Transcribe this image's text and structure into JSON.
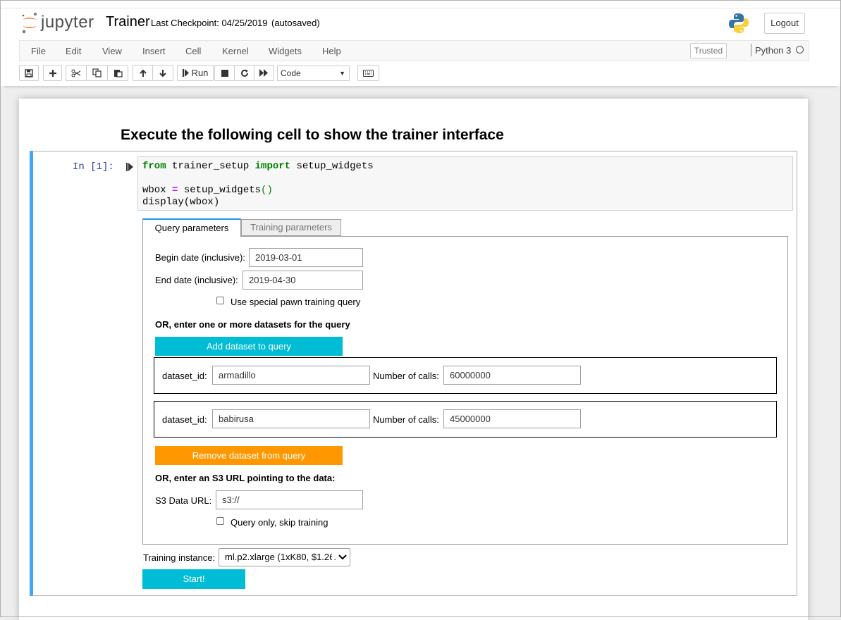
{
  "header": {
    "logo_text": "jupyter",
    "notebook_name": "Trainer",
    "checkpoint": "Last Checkpoint: 04/25/2019",
    "autosave": "(autosaved)",
    "logout": "Logout"
  },
  "menu": [
    "File",
    "Edit",
    "View",
    "Insert",
    "Cell",
    "Kernel",
    "Widgets",
    "Help"
  ],
  "status": {
    "trusted": "Trusted",
    "kernel": "Python 3"
  },
  "toolbar": {
    "run_label": "Run",
    "cell_type": "Code"
  },
  "notebook": {
    "heading": "Execute the following cell to show the trainer interface",
    "prompt": "In [1]:",
    "code": {
      "l1_kw1": "from",
      "l1_mod": " trainer_setup ",
      "l1_kw2": "import",
      "l1_name": " setup_widgets",
      "l3_var": "wbox ",
      "l3_op": "=",
      "l3_call": " setup_widgets",
      "l3_paren": "()",
      "l4": "display(wbox)"
    }
  },
  "widget": {
    "tabs": [
      "Query parameters",
      "Training parameters"
    ],
    "begin_label": "Begin date (inclusive):",
    "begin_value": "2019-03-01",
    "end_label": "End date (inclusive):",
    "end_value": "2019-04-30",
    "pawn_label": "Use special pawn training query",
    "datasets_heading": "OR, enter one or more datasets for the query",
    "add_button": "Add dataset to query",
    "datasets": [
      {
        "id_label": "dataset_id:",
        "id_value": "armadillo",
        "calls_label": "Number of calls:",
        "calls_value": "60000000"
      },
      {
        "id_label": "dataset_id:",
        "id_value": "babirusa",
        "calls_label": "Number of calls:",
        "calls_value": "45000000"
      }
    ],
    "remove_button": "Remove dataset from query",
    "s3_heading": "OR, enter an S3 URL pointing to the data:",
    "s3_label": "S3 Data URL:",
    "s3_value": "s3://",
    "query_only_label": "Query only, skip training",
    "instance_label": "Training instance:",
    "instance_value": "ml.p2.xlarge (1xK80, $1.26",
    "instance_truncation": ".",
    "start_button": "Start!"
  },
  "colors": {
    "accent": "#00bcd4",
    "warning": "#ff9800",
    "cell_border": "#42a5f5"
  },
  "icons": [
    "save-icon",
    "plus-icon",
    "scissors-icon",
    "copy-icon",
    "paste-icon",
    "arrow-up-icon",
    "arrow-down-icon",
    "step-icon",
    "stop-icon",
    "restart-icon",
    "fast-forward-icon",
    "keyboard-icon",
    "python-logo-icon"
  ]
}
